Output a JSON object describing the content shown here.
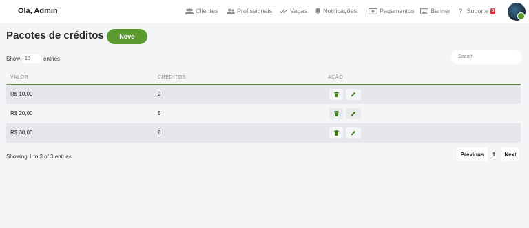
{
  "header": {
    "greeting": "Olá, Admin",
    "nav": [
      {
        "label": "Clientes",
        "icon": "users-icon"
      },
      {
        "label": "Profissionais",
        "icon": "user-group-icon"
      },
      {
        "label": "Vagas",
        "icon": "checks-icon"
      },
      {
        "label": "Notificações",
        "icon": "bell-icon"
      },
      {
        "label": "Pagamentos",
        "icon": "money-icon"
      },
      {
        "label": "Banner",
        "icon": "image-icon"
      },
      {
        "label": "Suporte",
        "icon": "question-icon",
        "badge": "0"
      }
    ]
  },
  "page": {
    "title": "Pacotes de créditos",
    "new_button": "Novo"
  },
  "controls": {
    "show_label": "Show",
    "entries_value": "10",
    "entries_label": "entries",
    "search_placeholder": "Search"
  },
  "table": {
    "columns": [
      "VALOR",
      "CRÉDITOS",
      "AÇÃO"
    ],
    "rows": [
      {
        "valor": "R$ 10,00",
        "creditos": "2"
      },
      {
        "valor": "R$ 20,00",
        "creditos": "5"
      },
      {
        "valor": "R$ 30,00",
        "creditos": "8"
      }
    ]
  },
  "footer": {
    "info": "Showing 1 to 3 of 3 entries",
    "previous": "Previous",
    "page": "1",
    "next": "Next"
  },
  "colors": {
    "accent": "#5a9a2f",
    "badge": "#d9363e",
    "background": "#f4f5f7"
  }
}
